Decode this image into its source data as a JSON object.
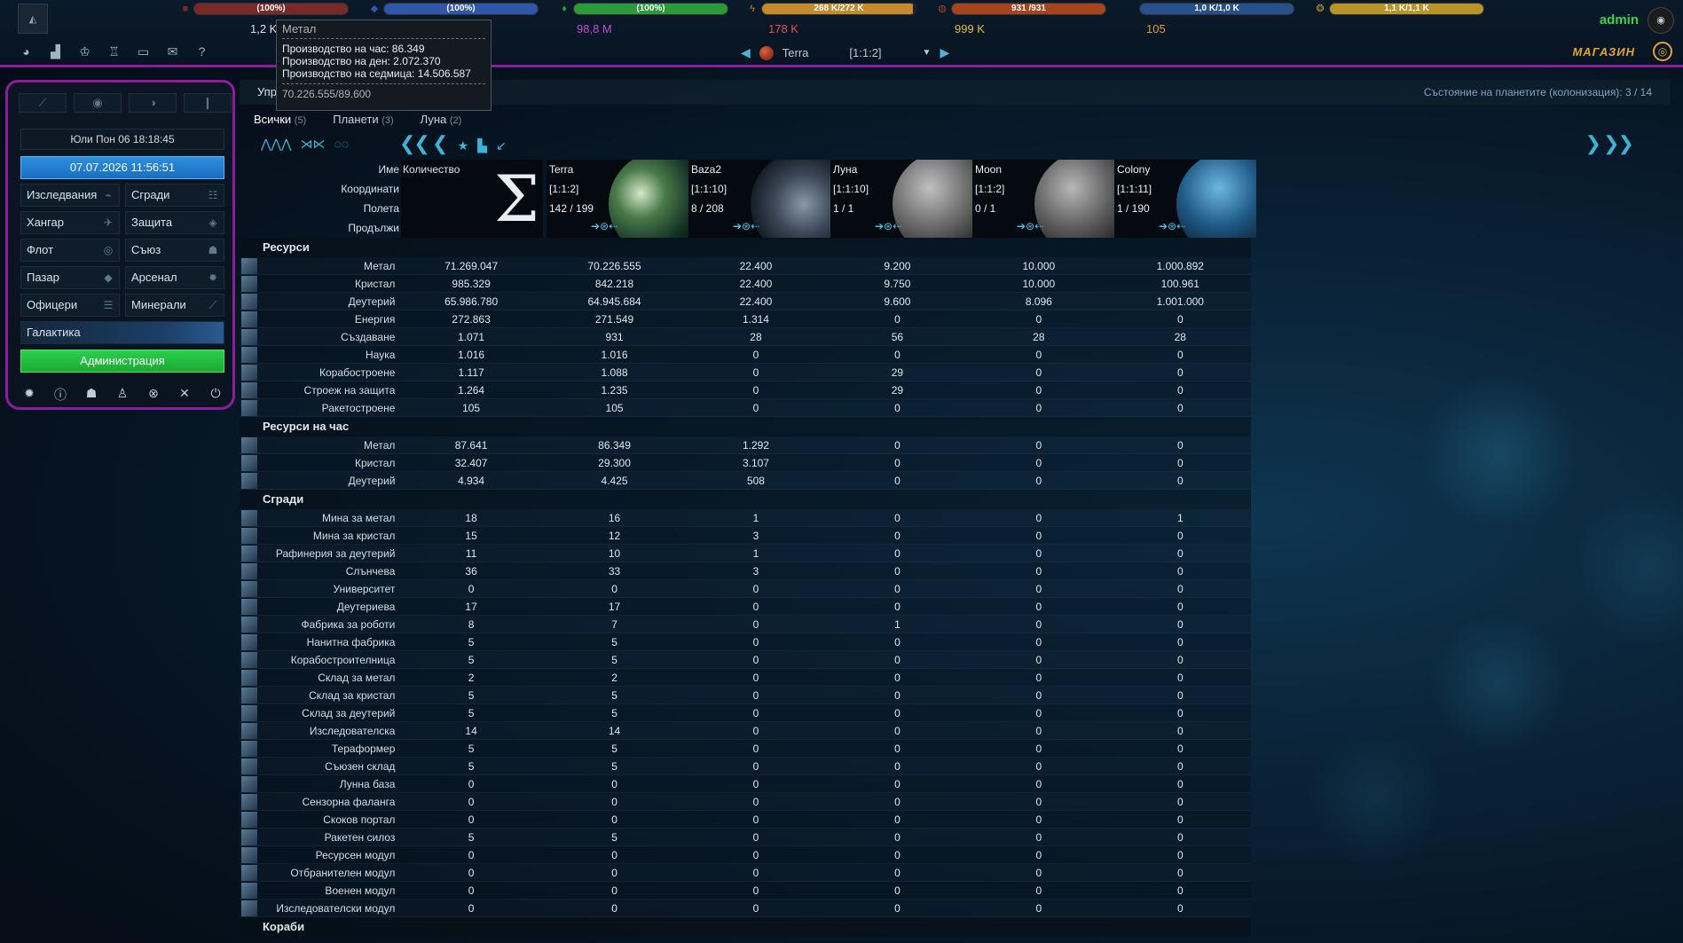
{
  "topbar": {
    "resources": [
      {
        "icon": "metal-icon",
        "bar": "(100%)",
        "pct": 100,
        "color": "#7a2a26",
        "text": "",
        "sub": "1,2 K"
      },
      {
        "icon": "crystal-icon",
        "bar": "(100%)",
        "pct": 100,
        "color": "#2f56a8",
        "text": "",
        "sub": ""
      },
      {
        "icon": "deuterium-icon",
        "bar": "(100%)",
        "pct": 100,
        "color": "#2c9a3a",
        "text": "",
        "sub": "98,8 M"
      },
      {
        "icon": "energy-icon",
        "bar": "268 K/272 K",
        "pct": 98,
        "color": "#c58a2e",
        "text": "",
        "sub": "178 K"
      },
      {
        "icon": "darkmatter-icon",
        "bar": "931 /931",
        "pct": 100,
        "color": "#a6441e",
        "text": "",
        "sub": "999 K"
      },
      {
        "icon": "",
        "bar": "1,0 K/1,0 K",
        "pct": 100,
        "color": "#26508c",
        "text": "",
        "sub": ""
      },
      {
        "icon": "gold-icon",
        "bar": "1,1 K/1,1 K",
        "pct": 100,
        "color": "#b8942a",
        "text": "",
        "sub": "105"
      }
    ],
    "username": "admin",
    "planet_name": "Terra",
    "planet_coords": "[1:1:2]",
    "shop_label": "МАГАЗИН"
  },
  "tooltip": {
    "title": "Метал",
    "per_hour": "Производство на час: 86.349",
    "per_day": "Производство на ден: 2.072.370",
    "per_week": "Производство на седмица: 14.506.587",
    "capacity": "70.226.555/89.600"
  },
  "leftmenu": {
    "date_server": "Юли Пон 06 18:18:45",
    "date_local": "07.07.2026 11:56:51",
    "buttons": [
      {
        "label": "Изследвания",
        "name": "research"
      },
      {
        "label": "Сгради",
        "name": "buildings"
      },
      {
        "label": "Хангар",
        "name": "hangar"
      },
      {
        "label": "Защита",
        "name": "defense"
      },
      {
        "label": "Флот",
        "name": "fleet"
      },
      {
        "label": "Съюз",
        "name": "alliance"
      },
      {
        "label": "Пазар",
        "name": "market"
      },
      {
        "label": "Арсенал",
        "name": "arsenal"
      },
      {
        "label": "Офицери",
        "name": "officers"
      },
      {
        "label": "Минерали",
        "name": "minerals"
      }
    ],
    "galaxy": "Галактика",
    "admin": "Администрация"
  },
  "main": {
    "title": "Упр",
    "status": "Състояние на планетите (колонизация): 3 / 14",
    "tabs": [
      {
        "label": "Всички",
        "count": "(5)"
      },
      {
        "label": "Планети",
        "count": "(3)"
      },
      {
        "label": "Луна",
        "count": "(2)"
      }
    ],
    "header_labels": [
      "Име",
      "Координати",
      "Полета",
      "Продължи"
    ],
    "sum_label": "Количество",
    "planets": [
      {
        "name": "Terra",
        "coords": "[1:1:2]",
        "fields": "142 / 199"
      },
      {
        "name": "Baza2",
        "coords": "[1:1:10]",
        "fields": "8 / 208"
      },
      {
        "name": "Луна",
        "coords": "[1:1:10]",
        "fields": "1 / 1"
      },
      {
        "name": "Moon",
        "coords": "[1:1:2]",
        "fields": "0 / 1"
      },
      {
        "name": "Colony",
        "coords": "[1:1:11]",
        "fields": "1 / 190"
      }
    ]
  },
  "sections": [
    {
      "title": "Ресурси",
      "rows": [
        {
          "name": "Метал",
          "values": [
            "71.269.047",
            "70.226.555",
            "22.400",
            "9.200",
            "10.000",
            "1.000.892"
          ]
        },
        {
          "name": "Кристал",
          "values": [
            "985.329",
            "842.218",
            "22.400",
            "9.750",
            "10.000",
            "100.961"
          ]
        },
        {
          "name": "Деутерий",
          "values": [
            "65.986.780",
            "64.945.684",
            "22.400",
            "9.600",
            "8.096",
            "1.001.000"
          ]
        },
        {
          "name": "Енергия",
          "values": [
            "272.863",
            "271.549",
            "1.314",
            "0",
            "0",
            "0"
          ]
        },
        {
          "name": "Създаване",
          "values": [
            "1.071",
            "931",
            "28",
            "56",
            "28",
            "28"
          ]
        },
        {
          "name": "Наука",
          "values": [
            "1.016",
            "1.016",
            "0",
            "0",
            "0",
            "0"
          ]
        },
        {
          "name": "Корабостроене",
          "values": [
            "1.117",
            "1.088",
            "0",
            "29",
            "0",
            "0"
          ]
        },
        {
          "name": "Строеж на защита",
          "values": [
            "1.264",
            "1.235",
            "0",
            "29",
            "0",
            "0"
          ]
        },
        {
          "name": "Ракетостроене",
          "values": [
            "105",
            "105",
            "0",
            "0",
            "0",
            "0"
          ]
        }
      ]
    },
    {
      "title": "Ресурси на час",
      "rows": [
        {
          "name": "Метал",
          "values": [
            "87.641",
            "86.349",
            "1.292",
            "0",
            "0",
            "0"
          ]
        },
        {
          "name": "Кристал",
          "values": [
            "32.407",
            "29.300",
            "3.107",
            "0",
            "0",
            "0"
          ]
        },
        {
          "name": "Деутерий",
          "values": [
            "4.934",
            "4.425",
            "508",
            "0",
            "0",
            "0"
          ]
        }
      ]
    },
    {
      "title": "Сгради",
      "rows": [
        {
          "name": "Мина за метал",
          "values": [
            "18",
            "16",
            "1",
            "0",
            "0",
            "1"
          ]
        },
        {
          "name": "Мина за кристал",
          "values": [
            "15",
            "12",
            "3",
            "0",
            "0",
            "0"
          ]
        },
        {
          "name": "Рафинерия за деутерий",
          "values": [
            "11",
            "10",
            "1",
            "0",
            "0",
            "0"
          ]
        },
        {
          "name": "Слънчева",
          "values": [
            "36",
            "33",
            "3",
            "0",
            "0",
            "0"
          ]
        },
        {
          "name": "Университет",
          "values": [
            "0",
            "0",
            "0",
            "0",
            "0",
            "0"
          ]
        },
        {
          "name": "Деутериева",
          "values": [
            "17",
            "17",
            "0",
            "0",
            "0",
            "0"
          ]
        },
        {
          "name": "Фабрика за роботи",
          "values": [
            "8",
            "7",
            "0",
            "1",
            "0",
            "0"
          ]
        },
        {
          "name": "Нанитна фабрика",
          "values": [
            "5",
            "5",
            "0",
            "0",
            "0",
            "0"
          ]
        },
        {
          "name": "Корабостроителница",
          "values": [
            "5",
            "5",
            "0",
            "0",
            "0",
            "0"
          ]
        },
        {
          "name": "Склад за метал",
          "values": [
            "2",
            "2",
            "0",
            "0",
            "0",
            "0"
          ]
        },
        {
          "name": "Склад за кристал",
          "values": [
            "5",
            "5",
            "0",
            "0",
            "0",
            "0"
          ]
        },
        {
          "name": "Склад за деутерий",
          "values": [
            "5",
            "5",
            "0",
            "0",
            "0",
            "0"
          ]
        },
        {
          "name": "Изследователска",
          "values": [
            "14",
            "14",
            "0",
            "0",
            "0",
            "0"
          ]
        },
        {
          "name": "Тераформер",
          "values": [
            "5",
            "5",
            "0",
            "0",
            "0",
            "0"
          ]
        },
        {
          "name": "Съюзен склад",
          "values": [
            "5",
            "5",
            "0",
            "0",
            "0",
            "0"
          ]
        },
        {
          "name": "Лунна база",
          "values": [
            "0",
            "0",
            "0",
            "0",
            "0",
            "0"
          ]
        },
        {
          "name": "Сензорна фаланга",
          "values": [
            "0",
            "0",
            "0",
            "0",
            "0",
            "0"
          ]
        },
        {
          "name": "Скоков портал",
          "values": [
            "0",
            "0",
            "0",
            "0",
            "0",
            "0"
          ]
        },
        {
          "name": "Ракетен силоз",
          "values": [
            "5",
            "5",
            "0",
            "0",
            "0",
            "0"
          ]
        },
        {
          "name": "Ресурсен модул",
          "values": [
            "0",
            "0",
            "0",
            "0",
            "0",
            "0"
          ]
        },
        {
          "name": "Отбранителен модул",
          "values": [
            "0",
            "0",
            "0",
            "0",
            "0",
            "0"
          ]
        },
        {
          "name": "Военен модул",
          "values": [
            "0",
            "0",
            "0",
            "0",
            "0",
            "0"
          ]
        },
        {
          "name": "Изследователски модул",
          "values": [
            "0",
            "0",
            "0",
            "0",
            "0",
            "0"
          ]
        }
      ]
    },
    {
      "title": "Кораби",
      "rows": []
    }
  ]
}
